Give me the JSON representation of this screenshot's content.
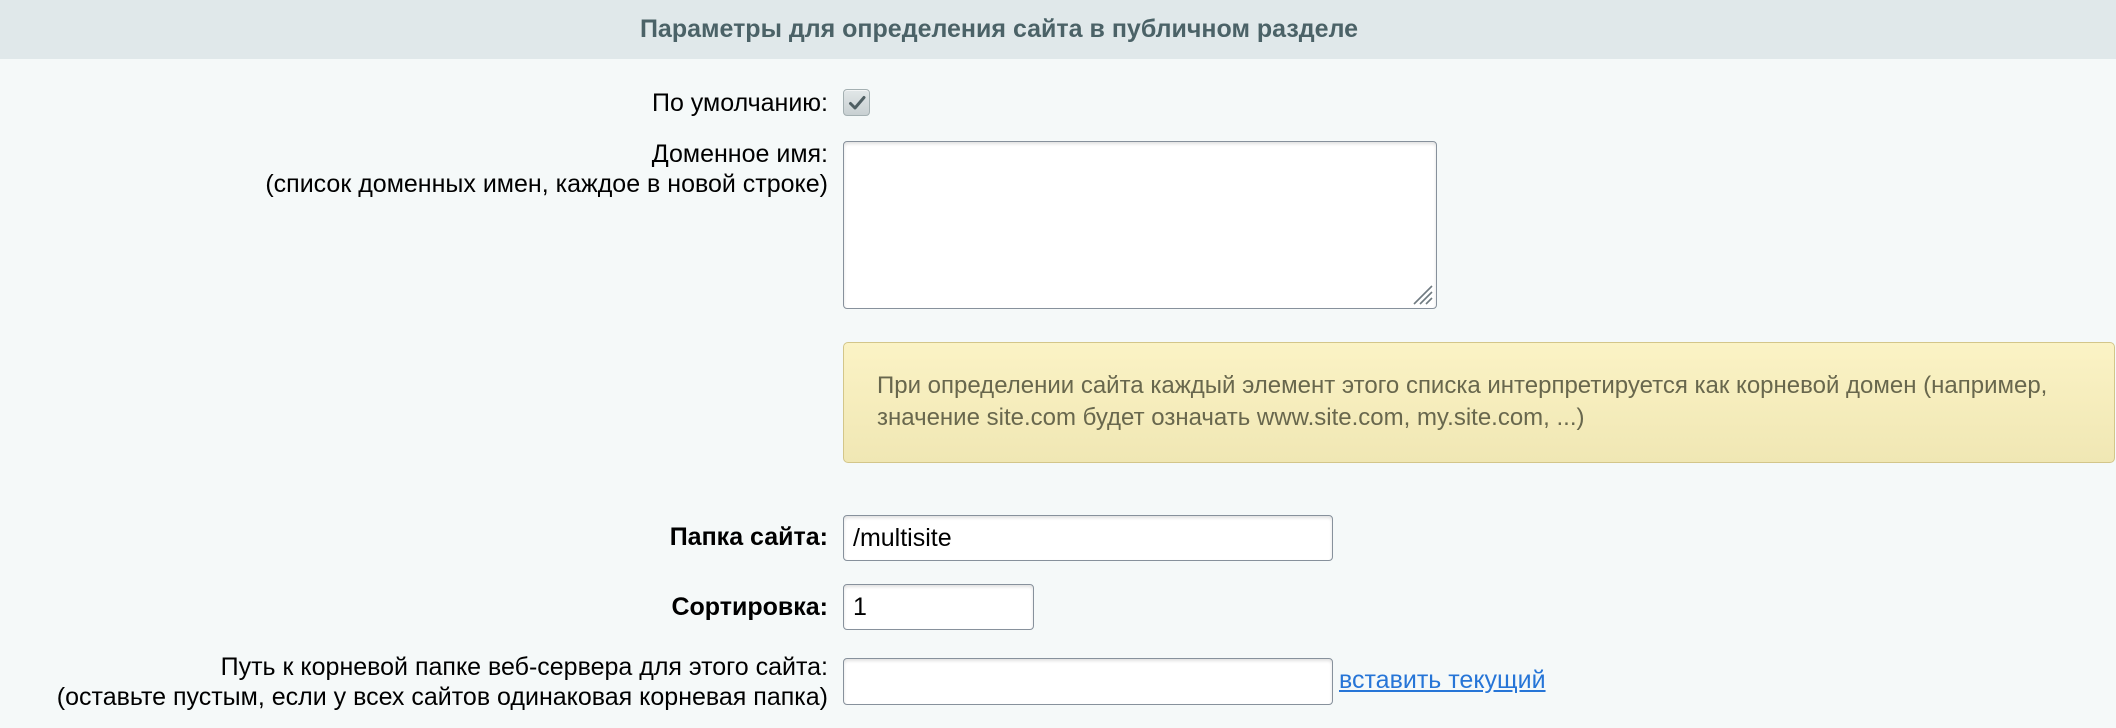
{
  "section": {
    "title": "Параметры для определения сайта в публичном разделе"
  },
  "fields": {
    "default": {
      "label": "По умолчанию:",
      "checked": true
    },
    "domain": {
      "label_line1": "Доменное имя:",
      "label_line2": "(список доменных имен, каждое в новой строке)",
      "value": ""
    },
    "notice": {
      "line1": "При определении сайта каждый элемент этого списка интерпретируется как корневой домен (например,",
      "line2": "значение site.com будет означать www.site.com, my.site.com, ...)"
    },
    "folder": {
      "label": "Папка сайта:",
      "value": "/multisite"
    },
    "sort": {
      "label": "Сортировка:",
      "value": "1"
    },
    "doc_root": {
      "label_line1": "Путь к корневой папке веб-сервера для этого сайта:",
      "label_line2": "(оставьте пустым, если у всех сайтов одинаковая корневая папка)",
      "value": "",
      "insert_link": "вставить текущий"
    }
  }
}
